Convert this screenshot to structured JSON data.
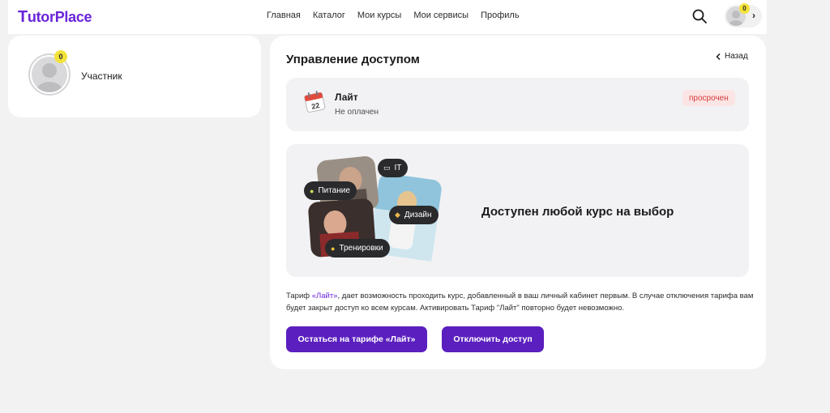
{
  "header": {
    "logo_initial": "T",
    "logo_text": "utorPlace",
    "nav": [
      "Главная",
      "Каталог",
      "Мои курсы",
      "Мои сервисы",
      "Профиль"
    ],
    "avatar_badge": "0",
    "search_icon": "search-icon",
    "chevron_icon": "chevron-right-icon"
  },
  "profile": {
    "badge": "0",
    "name": "Участник"
  },
  "main": {
    "title": "Управление доступом",
    "back_label": "Назад",
    "tariff": {
      "name": "Лайт",
      "status": "Не оплачен",
      "badge": "просрочен",
      "calendar_text": "22"
    },
    "promo": {
      "headline": "Доступен любой курс на выбор",
      "chips": [
        "IT",
        "Питание",
        "Дизайн",
        "Тренировки"
      ]
    },
    "description": {
      "prefix": "Тариф ",
      "accent": "«Лайт»",
      "rest": ", дает возможность проходить курс, добавленный в ваш личный кабинет первым. В случае отключения тарифа вам будет закрыт доступ ко всем курсам. Активировать Тариф \"Лайт\" повторно будет невозможно."
    },
    "buttons": {
      "stay": "Остаться на тарифе «Лайт»",
      "disable": "Отключить доступ"
    }
  },
  "colors": {
    "accent": "#5b1fbf",
    "background": "#f2f2f3",
    "expired_bg": "#fbe4e4",
    "expired_text": "#d43a3a",
    "badge": "#f3e23a"
  }
}
